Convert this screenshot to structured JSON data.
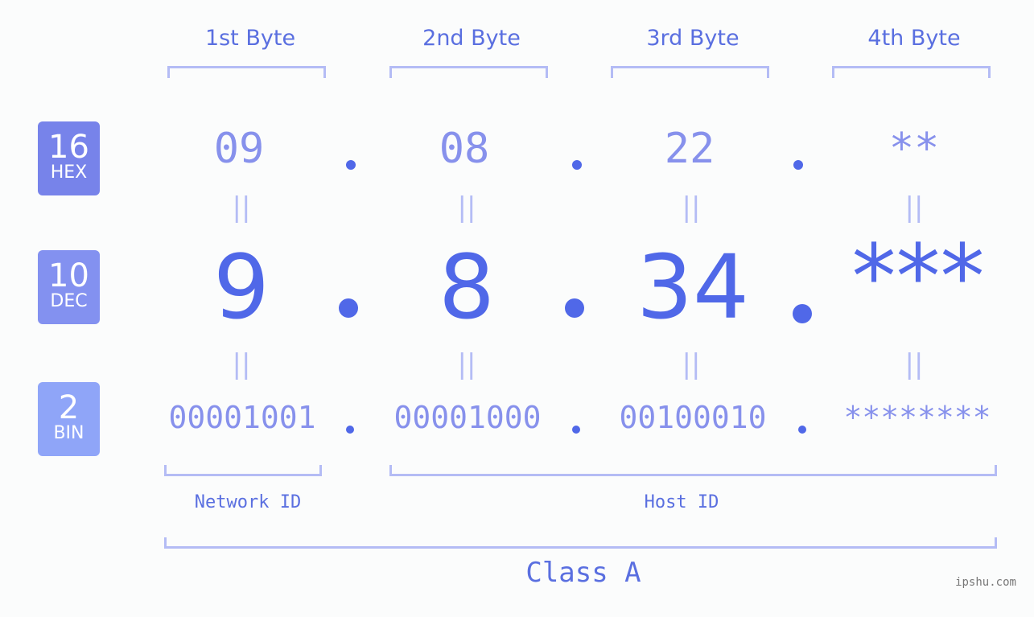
{
  "bytes": [
    {
      "label": "1st Byte",
      "hex": "09",
      "dec": "9",
      "bin": "00001001"
    },
    {
      "label": "2nd Byte",
      "hex": "08",
      "dec": "8",
      "bin": "00001000"
    },
    {
      "label": "3rd Byte",
      "hex": "22",
      "dec": "34",
      "bin": "00100010"
    },
    {
      "label": "4th Byte",
      "hex": "**",
      "dec": "***",
      "bin": "********"
    }
  ],
  "bases": {
    "hex": {
      "num": "16",
      "label": "HEX",
      "color": "#7783ea"
    },
    "dec": {
      "num": "10",
      "label": "DEC",
      "color": "#8391f0"
    },
    "bin": {
      "num": "2",
      "label": "BIN",
      "color": "#8fa5f8"
    }
  },
  "equals_sign": "||",
  "network_id_label": "Network ID",
  "host_id_label": "Host ID",
  "class_label": "Class A",
  "watermark": "ipshu.com",
  "colors": {
    "accent": "#5068e8",
    "light": "#8791ec",
    "bracket": "#b4bcf5"
  }
}
